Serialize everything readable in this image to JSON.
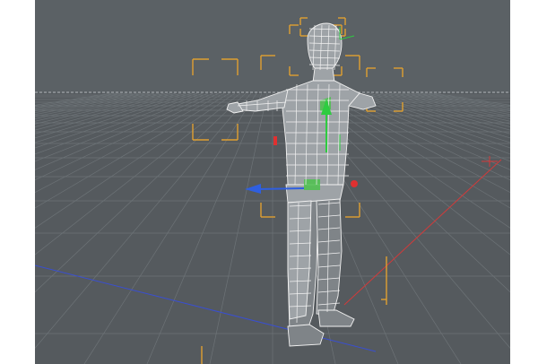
{
  "viewport": {
    "kind": "3d-perspective-viewport",
    "background_color": "#5b6165",
    "floor_color": "#555a5e",
    "grid_color": "#6d7377",
    "horizon_color": "#9ea4a8",
    "x_axis_color": "#d23a3a",
    "z_axis_color": "#3a4fd0",
    "selection_bracket_color": "#e0a030"
  },
  "scene": {
    "object": "t-pose-character-mesh",
    "display_mode": "wireframe-shaded",
    "mesh_fill_color": "#9ea3a7",
    "mesh_shade_color": "#7f8488",
    "wire_color": "#f2f2f2",
    "highlight_color": "#4cc24c"
  },
  "gizmo": {
    "x_handle_color": "#e03030",
    "y_handle_color": "#2ecc40",
    "z_handle_color": "#2f5fe0"
  }
}
